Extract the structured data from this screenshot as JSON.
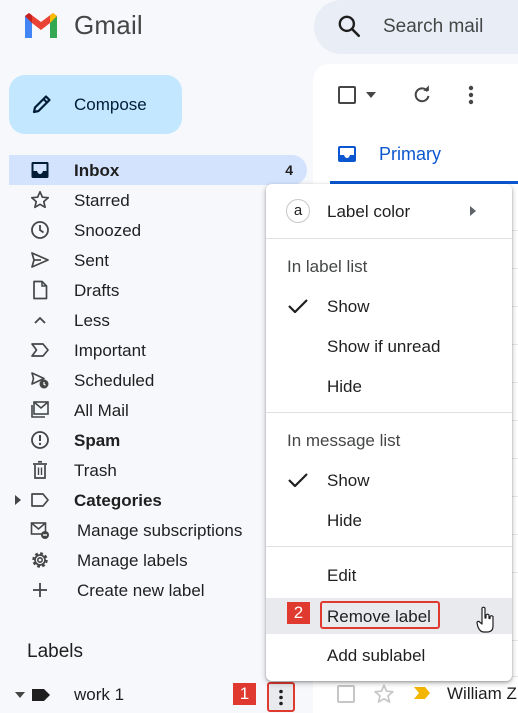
{
  "header": {
    "app_name": "Gmail",
    "search_placeholder": "Search mail"
  },
  "compose": {
    "label": "Compose"
  },
  "sidebar": {
    "items": [
      {
        "label": "Inbox",
        "count": "4",
        "icon": "inbox-icon"
      },
      {
        "label": "Starred",
        "icon": "star-icon"
      },
      {
        "label": "Snoozed",
        "icon": "clock-icon"
      },
      {
        "label": "Sent",
        "icon": "send-icon"
      },
      {
        "label": "Drafts",
        "icon": "draft-icon"
      },
      {
        "label": "Less",
        "icon": "chevron-up-icon"
      },
      {
        "label": "Important",
        "icon": "important-icon"
      },
      {
        "label": "Scheduled",
        "icon": "scheduled-icon"
      },
      {
        "label": "All Mail",
        "icon": "all-mail-icon"
      },
      {
        "label": "Spam",
        "icon": "spam-icon"
      },
      {
        "label": "Trash",
        "icon": "trash-icon"
      },
      {
        "label": "Categories",
        "icon": "label-outline-icon"
      },
      {
        "label": "Manage subscriptions",
        "icon": "manage-subscriptions-icon"
      },
      {
        "label": "Manage labels",
        "icon": "gear-icon"
      },
      {
        "label": "Create new label",
        "icon": "plus-icon"
      }
    ],
    "labels_title": "Labels",
    "labels": [
      {
        "label": "work 1"
      }
    ]
  },
  "toolbar": {},
  "tabs": {
    "primary": "Primary"
  },
  "email_rows": [
    {
      "sender": "William Z"
    }
  ],
  "context_menu": {
    "label_color": "Label color",
    "label_color_chip": "a",
    "section_label_list": "In label list",
    "label_list_show": "Show",
    "label_list_show_if_unread": "Show if unread",
    "label_list_hide": "Hide",
    "section_message_list": "In message list",
    "message_list_show": "Show",
    "message_list_hide": "Hide",
    "edit": "Edit",
    "remove_label": "Remove label",
    "add_sublabel": "Add sublabel"
  },
  "annotations": {
    "step1": "1",
    "step2": "2"
  },
  "colors": {
    "background": "#f6f8fc",
    "compose_bg": "#c2e7ff",
    "active_nav_bg": "#d3e3fd",
    "accent_blue": "#0b57d0",
    "annotation_red": "#e0392f",
    "important_yellow": "#f2b600"
  }
}
